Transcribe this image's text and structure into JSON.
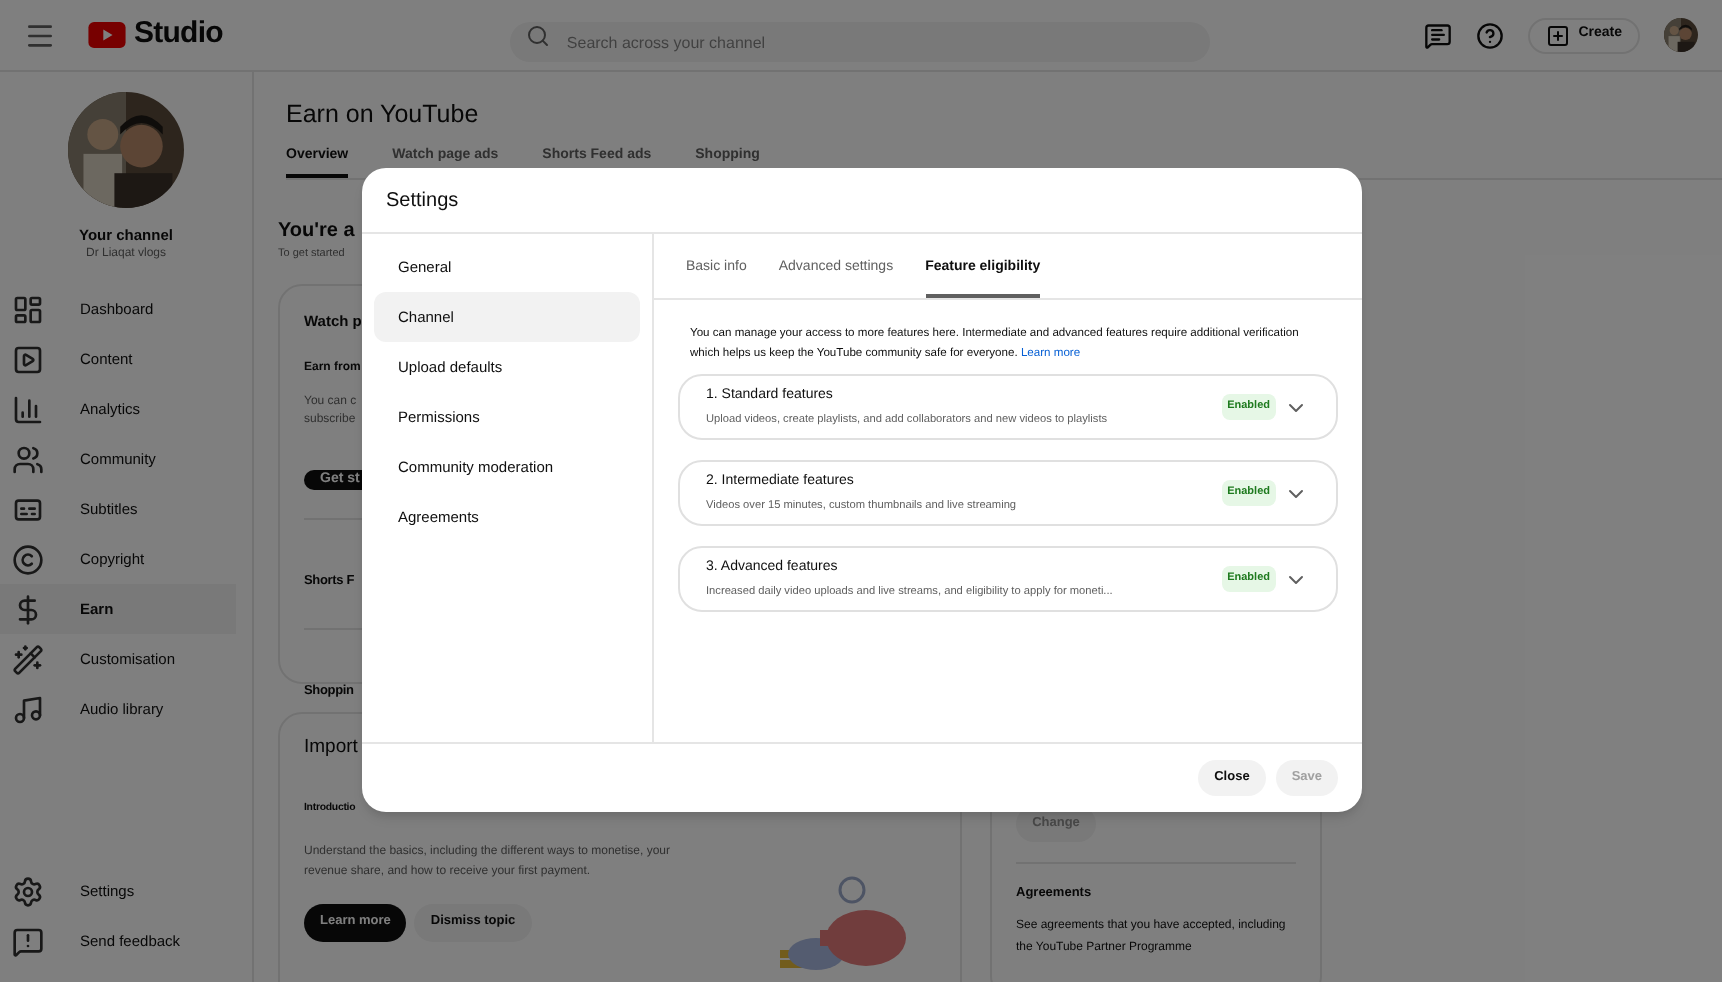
{
  "header": {
    "logo_text": "Studio",
    "search": {
      "placeholder": "Search across your channel"
    },
    "create_button": "Create"
  },
  "sidebar": {
    "channel_title": "Your channel",
    "channel_name": "Dr Liaqat vlogs",
    "items": [
      {
        "label": "Dashboard",
        "kind": "dashboard",
        "selected": false
      },
      {
        "label": "Content",
        "kind": "content",
        "selected": false
      },
      {
        "label": "Analytics",
        "kind": "analytics",
        "selected": false
      },
      {
        "label": "Community",
        "kind": "community",
        "selected": false
      },
      {
        "label": "Subtitles",
        "kind": "subtitles",
        "selected": false
      },
      {
        "label": "Copyright",
        "kind": "copyright",
        "selected": false
      },
      {
        "label": "Earn",
        "kind": "earn",
        "selected": true
      },
      {
        "label": "Customisation",
        "kind": "customisation",
        "selected": false
      },
      {
        "label": "Audio library",
        "kind": "audio",
        "selected": false
      }
    ],
    "footer_items": [
      {
        "label": "Settings",
        "kind": "settings"
      },
      {
        "label": "Send feedback",
        "kind": "feedback"
      }
    ]
  },
  "page": {
    "title": "Earn on YouTube",
    "tabs": [
      {
        "label": "Overview",
        "selected": true
      },
      {
        "label": "Watch page ads",
        "selected": false
      },
      {
        "label": "Shorts Feed ads",
        "selected": false
      },
      {
        "label": "Shopping",
        "selected": false
      }
    ],
    "banner_title": "You're a",
    "banner_text": "To get started",
    "card": {
      "title": "Watch p",
      "subtitle": "Earn from",
      "text_lines": [
        "You can c",
        "subscribe"
      ],
      "button": "Get st",
      "rows": [
        "Shorts F",
        "Shoppin"
      ]
    },
    "topic": {
      "title": "Import",
      "subtitle": "Introductio",
      "text": "Understand the basics, including the different ways to monetise, your revenue share, and how to receive your first payment.",
      "primary_button": "Learn more",
      "secondary_button": "Dismiss topic"
    },
    "side_card": {
      "button": "Change",
      "title": "Agreements",
      "text": "See agreements that you have accepted, including the YouTube Partner Programme"
    }
  },
  "dialog": {
    "title": "Settings",
    "nav": [
      {
        "label": "General",
        "selected": false
      },
      {
        "label": "Channel",
        "selected": true
      },
      {
        "label": "Upload defaults",
        "selected": false
      },
      {
        "label": "Permissions",
        "selected": false
      },
      {
        "label": "Community moderation",
        "selected": false
      },
      {
        "label": "Agreements",
        "selected": false
      }
    ],
    "tabs": [
      {
        "label": "Basic info",
        "selected": false
      },
      {
        "label": "Advanced settings",
        "selected": false
      },
      {
        "label": "Feature eligibility",
        "selected": true
      }
    ],
    "intro": "You can manage your access to more features here. Intermediate and advanced features require additional verification which helps us keep the YouTube community safe for everyone.",
    "learn_more": "Learn more",
    "features": [
      {
        "title": "1. Standard features",
        "description": "Upload videos, create playlists, and add collaborators and new videos to playlists",
        "status": "Enabled",
        "enabled": true
      },
      {
        "title": "2. Intermediate features",
        "description": "Videos over 15 minutes, custom thumbnails and live streaming",
        "status": "Enabled",
        "enabled": true
      },
      {
        "title": "3. Advanced features",
        "description": "Increased daily video uploads and live streams, and eligibility to apply for moneti...",
        "status": "Enabled",
        "enabled": true
      }
    ],
    "close_button": "Close",
    "save_button": {
      "label": "Save",
      "disabled": true
    }
  }
}
